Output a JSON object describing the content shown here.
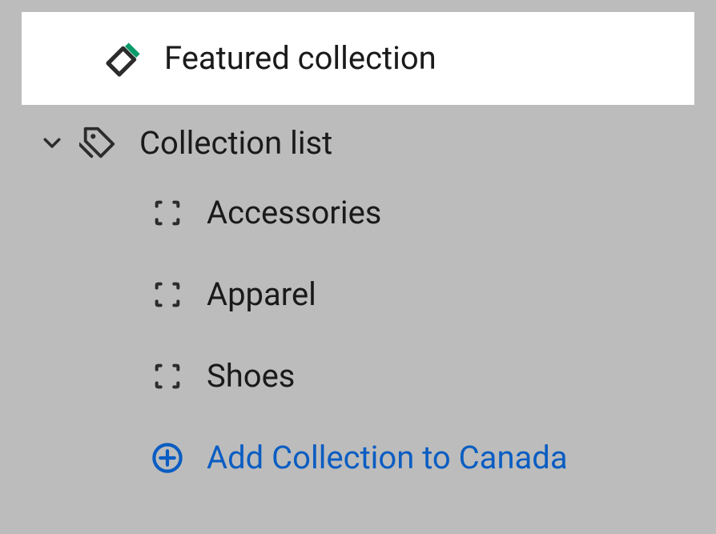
{
  "featured": {
    "label": "Featured collection"
  },
  "collection_list": {
    "label": "Collection list",
    "items": [
      {
        "label": "Accessories"
      },
      {
        "label": "Apparel"
      },
      {
        "label": "Shoes"
      }
    ],
    "add_label": "Add Collection to Canada"
  },
  "colors": {
    "accent_green": "#0a9b6b",
    "link_blue": "#0a5dc2",
    "icon_gray": "#2c2c2c"
  }
}
